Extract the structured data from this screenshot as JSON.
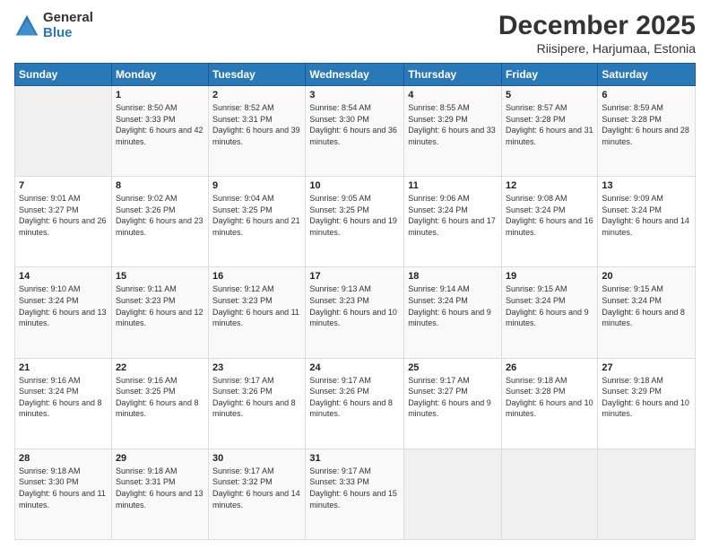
{
  "header": {
    "logo_general": "General",
    "logo_blue": "Blue",
    "month_title": "December 2025",
    "location": "Riisipere, Harjumaa, Estonia"
  },
  "days_of_week": [
    "Sunday",
    "Monday",
    "Tuesday",
    "Wednesday",
    "Thursday",
    "Friday",
    "Saturday"
  ],
  "weeks": [
    [
      {
        "num": "",
        "sunrise": "",
        "sunset": "",
        "daylight": ""
      },
      {
        "num": "1",
        "sunrise": "Sunrise: 8:50 AM",
        "sunset": "Sunset: 3:33 PM",
        "daylight": "Daylight: 6 hours and 42 minutes."
      },
      {
        "num": "2",
        "sunrise": "Sunrise: 8:52 AM",
        "sunset": "Sunset: 3:31 PM",
        "daylight": "Daylight: 6 hours and 39 minutes."
      },
      {
        "num": "3",
        "sunrise": "Sunrise: 8:54 AM",
        "sunset": "Sunset: 3:30 PM",
        "daylight": "Daylight: 6 hours and 36 minutes."
      },
      {
        "num": "4",
        "sunrise": "Sunrise: 8:55 AM",
        "sunset": "Sunset: 3:29 PM",
        "daylight": "Daylight: 6 hours and 33 minutes."
      },
      {
        "num": "5",
        "sunrise": "Sunrise: 8:57 AM",
        "sunset": "Sunset: 3:28 PM",
        "daylight": "Daylight: 6 hours and 31 minutes."
      },
      {
        "num": "6",
        "sunrise": "Sunrise: 8:59 AM",
        "sunset": "Sunset: 3:28 PM",
        "daylight": "Daylight: 6 hours and 28 minutes."
      }
    ],
    [
      {
        "num": "7",
        "sunrise": "Sunrise: 9:01 AM",
        "sunset": "Sunset: 3:27 PM",
        "daylight": "Daylight: 6 hours and 26 minutes."
      },
      {
        "num": "8",
        "sunrise": "Sunrise: 9:02 AM",
        "sunset": "Sunset: 3:26 PM",
        "daylight": "Daylight: 6 hours and 23 minutes."
      },
      {
        "num": "9",
        "sunrise": "Sunrise: 9:04 AM",
        "sunset": "Sunset: 3:25 PM",
        "daylight": "Daylight: 6 hours and 21 minutes."
      },
      {
        "num": "10",
        "sunrise": "Sunrise: 9:05 AM",
        "sunset": "Sunset: 3:25 PM",
        "daylight": "Daylight: 6 hours and 19 minutes."
      },
      {
        "num": "11",
        "sunrise": "Sunrise: 9:06 AM",
        "sunset": "Sunset: 3:24 PM",
        "daylight": "Daylight: 6 hours and 17 minutes."
      },
      {
        "num": "12",
        "sunrise": "Sunrise: 9:08 AM",
        "sunset": "Sunset: 3:24 PM",
        "daylight": "Daylight: 6 hours and 16 minutes."
      },
      {
        "num": "13",
        "sunrise": "Sunrise: 9:09 AM",
        "sunset": "Sunset: 3:24 PM",
        "daylight": "Daylight: 6 hours and 14 minutes."
      }
    ],
    [
      {
        "num": "14",
        "sunrise": "Sunrise: 9:10 AM",
        "sunset": "Sunset: 3:24 PM",
        "daylight": "Daylight: 6 hours and 13 minutes."
      },
      {
        "num": "15",
        "sunrise": "Sunrise: 9:11 AM",
        "sunset": "Sunset: 3:23 PM",
        "daylight": "Daylight: 6 hours and 12 minutes."
      },
      {
        "num": "16",
        "sunrise": "Sunrise: 9:12 AM",
        "sunset": "Sunset: 3:23 PM",
        "daylight": "Daylight: 6 hours and 11 minutes."
      },
      {
        "num": "17",
        "sunrise": "Sunrise: 9:13 AM",
        "sunset": "Sunset: 3:23 PM",
        "daylight": "Daylight: 6 hours and 10 minutes."
      },
      {
        "num": "18",
        "sunrise": "Sunrise: 9:14 AM",
        "sunset": "Sunset: 3:24 PM",
        "daylight": "Daylight: 6 hours and 9 minutes."
      },
      {
        "num": "19",
        "sunrise": "Sunrise: 9:15 AM",
        "sunset": "Sunset: 3:24 PM",
        "daylight": "Daylight: 6 hours and 9 minutes."
      },
      {
        "num": "20",
        "sunrise": "Sunrise: 9:15 AM",
        "sunset": "Sunset: 3:24 PM",
        "daylight": "Daylight: 6 hours and 8 minutes."
      }
    ],
    [
      {
        "num": "21",
        "sunrise": "Sunrise: 9:16 AM",
        "sunset": "Sunset: 3:24 PM",
        "daylight": "Daylight: 6 hours and 8 minutes."
      },
      {
        "num": "22",
        "sunrise": "Sunrise: 9:16 AM",
        "sunset": "Sunset: 3:25 PM",
        "daylight": "Daylight: 6 hours and 8 minutes."
      },
      {
        "num": "23",
        "sunrise": "Sunrise: 9:17 AM",
        "sunset": "Sunset: 3:26 PM",
        "daylight": "Daylight: 6 hours and 8 minutes."
      },
      {
        "num": "24",
        "sunrise": "Sunrise: 9:17 AM",
        "sunset": "Sunset: 3:26 PM",
        "daylight": "Daylight: 6 hours and 8 minutes."
      },
      {
        "num": "25",
        "sunrise": "Sunrise: 9:17 AM",
        "sunset": "Sunset: 3:27 PM",
        "daylight": "Daylight: 6 hours and 9 minutes."
      },
      {
        "num": "26",
        "sunrise": "Sunrise: 9:18 AM",
        "sunset": "Sunset: 3:28 PM",
        "daylight": "Daylight: 6 hours and 10 minutes."
      },
      {
        "num": "27",
        "sunrise": "Sunrise: 9:18 AM",
        "sunset": "Sunset: 3:29 PM",
        "daylight": "Daylight: 6 hours and 10 minutes."
      }
    ],
    [
      {
        "num": "28",
        "sunrise": "Sunrise: 9:18 AM",
        "sunset": "Sunset: 3:30 PM",
        "daylight": "Daylight: 6 hours and 11 minutes."
      },
      {
        "num": "29",
        "sunrise": "Sunrise: 9:18 AM",
        "sunset": "Sunset: 3:31 PM",
        "daylight": "Daylight: 6 hours and 13 minutes."
      },
      {
        "num": "30",
        "sunrise": "Sunrise: 9:17 AM",
        "sunset": "Sunset: 3:32 PM",
        "daylight": "Daylight: 6 hours and 14 minutes."
      },
      {
        "num": "31",
        "sunrise": "Sunrise: 9:17 AM",
        "sunset": "Sunset: 3:33 PM",
        "daylight": "Daylight: 6 hours and 15 minutes."
      },
      {
        "num": "",
        "sunrise": "",
        "sunset": "",
        "daylight": ""
      },
      {
        "num": "",
        "sunrise": "",
        "sunset": "",
        "daylight": ""
      },
      {
        "num": "",
        "sunrise": "",
        "sunset": "",
        "daylight": ""
      }
    ]
  ]
}
